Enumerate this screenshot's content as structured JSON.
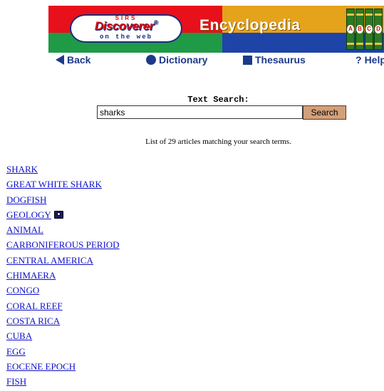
{
  "banner": {
    "logo_sirs": "SIRS",
    "logo_name": "Discoverer",
    "logo_mark": "®",
    "logo_sub": "on the web",
    "title": "Encyclopedia",
    "book_letters": [
      "A",
      "B",
      "C",
      "D"
    ]
  },
  "nav": [
    {
      "label": "Back",
      "icon": "back-arrow-icon"
    },
    {
      "label": "Dictionary",
      "icon": "circle-icon"
    },
    {
      "label": "Thesaurus",
      "icon": "square-icon"
    },
    {
      "label": "Help",
      "icon": "question-icon",
      "prefix": "?"
    }
  ],
  "search": {
    "label": "Text Search:",
    "value": "sharks",
    "button_label": "Search"
  },
  "results_summary": "List of 29 articles matching your search terms.",
  "results": [
    {
      "title": "SHARK"
    },
    {
      "title": "GREAT WHITE SHARK"
    },
    {
      "title": "DOGFISH"
    },
    {
      "title": "GEOLOGY",
      "has_image": true
    },
    {
      "title": "ANIMAL"
    },
    {
      "title": "CARBONIFEROUS PERIOD"
    },
    {
      "title": "CENTRAL AMERICA"
    },
    {
      "title": "CHIMAERA"
    },
    {
      "title": "CONGO"
    },
    {
      "title": "CORAL REEF"
    },
    {
      "title": "COSTA RICA"
    },
    {
      "title": "CUBA"
    },
    {
      "title": "EGG"
    },
    {
      "title": "EOCENE EPOCH"
    },
    {
      "title": "FISH"
    }
  ],
  "colors": {
    "banner_red": "#e8101a",
    "banner_green": "#1f9a47",
    "banner_yellow": "#e5a21b",
    "banner_blue": "#1f44a8",
    "nav_text": "#1c3a8a",
    "link": "#1010c8",
    "search_button": "#d2a07b"
  }
}
